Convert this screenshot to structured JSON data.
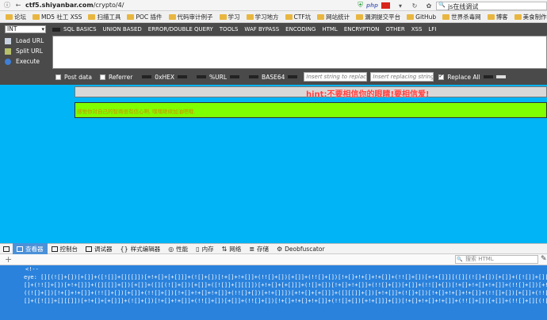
{
  "browser": {
    "url_host": "ctf5.shiyanbar.com",
    "url_path": "/crypto/4/",
    "search_value": "js在线调试"
  },
  "bookmarks": [
    "论坛",
    "MD5 社工 XSS",
    "扫描工具",
    "POC 插件",
    "代码审计例子",
    "学习",
    "学习地方",
    "CTF坑",
    "网站统计",
    "漏洞提交平台",
    "GitHub",
    "世界杀毒网",
    "博客",
    "美食制作",
    "杂七杂八"
  ],
  "hackbar": {
    "select_value": "INT",
    "menu": [
      "SQL BASICS",
      "UNION BASED",
      "ERROR/DOUBLE QUERY",
      "TOOLS",
      "WAF BYPASS",
      "ENCODING",
      "HTML",
      "ENCRYPTION",
      "OTHER",
      "XSS",
      "LFI"
    ],
    "side": {
      "load": "Load URL",
      "split": "Split URL",
      "execute": "Execute"
    },
    "options": {
      "post": "Post data",
      "referrer": "Referrer",
      "hex": "0xHEX",
      "url": "%URL",
      "base64": "BASE64",
      "find_placeholder": "Insert string to replace",
      "replace_placeholder": "Insert replacing string",
      "replace_all": "Replace All"
    }
  },
  "page": {
    "hint": "hint:不要相信你的眼睛!要相信爱!",
    "message": "感觉你对自己的智商很有信心啊, 嘿嘿继续加油吧哦."
  },
  "devtools": {
    "tabs": [
      "查看器",
      "控制台",
      "调试器",
      "样式编辑器",
      "性能",
      "内存",
      "网络",
      "存储",
      "Deobfuscator"
    ],
    "search_placeholder": "搜索 HTML",
    "code_lines": [
      "<!--",
      "eye: [][(![]+[])[+[]]+([![]]+[][[]])[+!+[]+[+[]]]+(![]+[])[!+[]+!+[]]+(!![]+[])[+[]]+(!![]+[])[!+[]+!+[]+!+[]]+(!![]+[])[+!+[]]][([][(![]+[])[+[]]+([![]]+[][[]])[+!+[]+[+[]]]+(![]+[])[!+[]+!+[]]+(!![]+[])[+[]]+(!![]+[])[!+[]+!+[]+!+[]]+(!![]+[])[+!+[]]]+[])[!+[]+!+[]+!+[]]+(!![]+[][(![]+[])[+[]]+([![]]+[][[]])[+!+[]+[+[]]]+(![]+[])[!+[]+!+[]]+(!![]+[])[+[]]+(!![]+[])[!+[]+!+[]+!+[]]+(!![]+[])[+!+[]]])[+!+[]+[+[]]]",
      "[]+(!![]+[])[+!+[]]]+([][[]]+[])[+[]]+([][(![]+[])[+[]]+([![]]+[][[]])[+!+[]+[+[]]]+(![]+[])[!+[]+!+[]]+(!![]+[])[+[]]+(!![]+[])[!+[]+!+[]+!+[]]+(!![]+[])[+!+[]]]+[])[!+[]+!+[]+!+[]]+(!![]+[])[+[]]+(!![]+[][(![]+[])[+[]]+([![]]+[][[]])[+!+[]+[+[]]]+(![]+[])[!+[]+!+[]]+(!![]+[])[+[]]",
      "((![]+[])[!+[]+!+[]]+(!![]+[])[+[]]+(!![]+[])[!+[]+!+[]+!+[]]+(!![]+[])[+!+[]]])[+!+[]+[+[]]]+([][[]]+[])[+!+[]]+(![]+[])[!+[]+!+[]+!+[]]+(!![]+[])[+[]]+(!![]+[])[+!+[]]+([][[]]+[])[+[]]+([][(![]+[])[+[]]+([![]]+[][[]])[+!+[]+[+[]]]+(![]+[])[!+[]+!+[]]+(!![]+[])[+[]]",
      "[]+([![]]+[][[]])[+!+[]+[+[]]]+(![]+[])[!+[]+!+[]]+(!![]+[])[+[]]+(!![]+[])[!+[]+!+[]+!+[]]+(!![]+[])[+!+[]]]+[])[!+[]+!+[]+!+[]]+(!![]+[])[+[]]+(!![]+[][(![]+[])[+[]]+([![]]+[][[]])[+!+[]+[+[]]]+(![]+[])[!+[]+!+[]]+(!![]+[])[+[]]+(!![]+[])[!+[]+!+[]+!+[]]+(!![]+[])[+!+[]]])[+!+[]+[+[]]]"
    ]
  },
  "colors": {
    "page_bg": "#00b4f5",
    "message_bar": "#7fff00",
    "hint": "#ff3c3c",
    "devtools_body": "#2a82dc",
    "devtools_active_tab": "#4b91d8"
  }
}
